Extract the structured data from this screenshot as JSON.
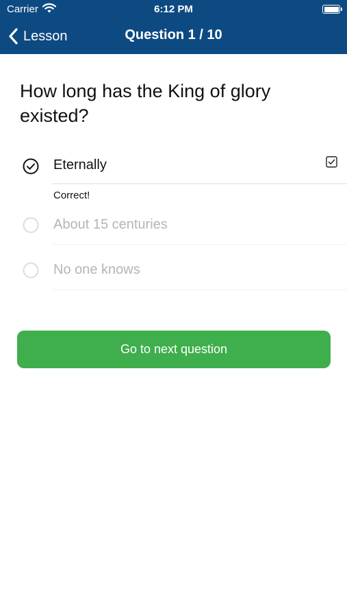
{
  "status_bar": {
    "carrier": "Carrier",
    "time": "6:12 PM"
  },
  "nav": {
    "back_label": "Lesson",
    "title": "Question 1 / 10"
  },
  "question": {
    "text": "How long has the King of glory existed?"
  },
  "options": [
    {
      "label": "Eternally",
      "state": "selected-correct"
    },
    {
      "label": "About 15 centuries",
      "state": "disabled"
    },
    {
      "label": "No one knows",
      "state": "disabled"
    }
  ],
  "feedback": "Correct!",
  "next_button": {
    "label": "Go to next question"
  },
  "colors": {
    "nav_bar": "#0e4a82",
    "button": "#3fae4c",
    "disabled_text": "#b5b5b5"
  },
  "icons": {
    "selected_option": "check-circle-icon",
    "answer_mark": "checkbox-checked-icon",
    "back": "chevron-left-icon"
  }
}
